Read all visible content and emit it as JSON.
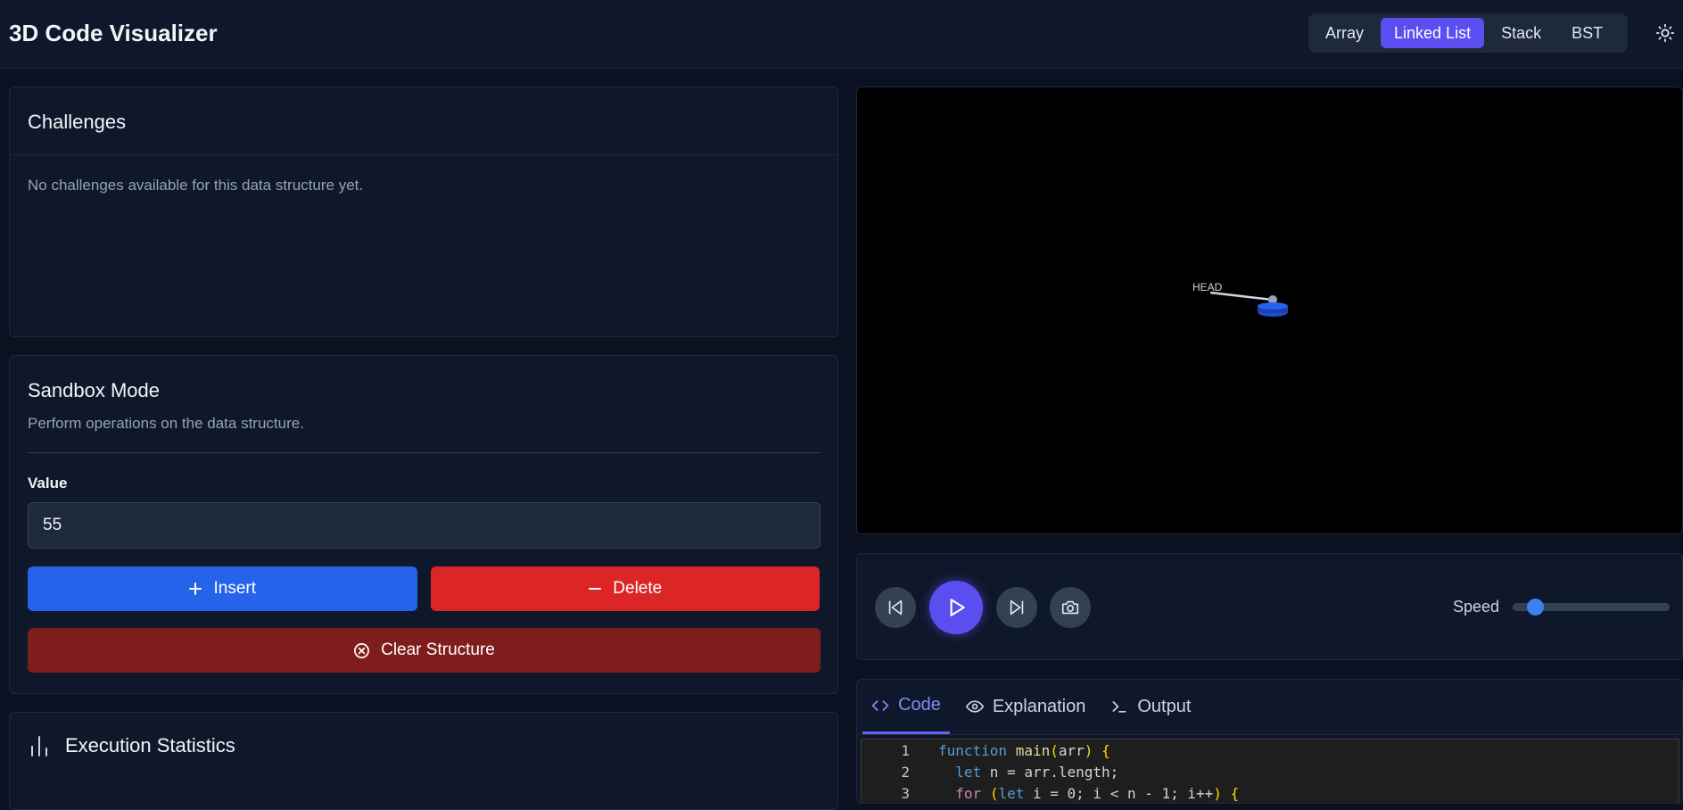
{
  "header": {
    "app_title": "3D Code Visualizer",
    "tabs": [
      {
        "label": "Array",
        "active": false
      },
      {
        "label": "Linked List",
        "active": true
      },
      {
        "label": "Stack",
        "active": false
      },
      {
        "label": "BST",
        "active": false
      }
    ],
    "theme_icon": "sun-icon"
  },
  "challenges": {
    "title": "Challenges",
    "empty_message": "No challenges available for this data structure yet."
  },
  "sandbox": {
    "title": "Sandbox Mode",
    "description": "Perform operations on the data structure.",
    "value_label": "Value",
    "value": "55",
    "insert_label": "Insert",
    "delete_label": "Delete",
    "clear_label": "Clear Structure"
  },
  "stats": {
    "title": "Execution Statistics"
  },
  "viewport": {
    "head_label": "HEAD",
    "background": "#000000",
    "node_color": "#1d4ed8"
  },
  "controls": {
    "speed_label": "Speed",
    "speed_value": 0.1,
    "buttons": [
      "step-back-icon",
      "play-icon",
      "step-forward-icon",
      "camera-icon"
    ]
  },
  "code_panel": {
    "tabs": [
      {
        "label": "Code",
        "icon": "code-icon",
        "active": true
      },
      {
        "label": "Explanation",
        "icon": "eye-icon",
        "active": false
      },
      {
        "label": "Output",
        "icon": "terminal-icon",
        "active": false
      }
    ],
    "lines": [
      {
        "num": "1",
        "text": "function main(arr) {"
      },
      {
        "num": "2",
        "text": "  let n = arr.length;"
      },
      {
        "num": "3",
        "text": "  for (let i = 0; i < n - 1; i++) {"
      }
    ]
  },
  "colors": {
    "accent": "#5b4ef0",
    "insert": "#2563eb",
    "delete": "#dc2626",
    "clear": "#7f1d1d"
  }
}
